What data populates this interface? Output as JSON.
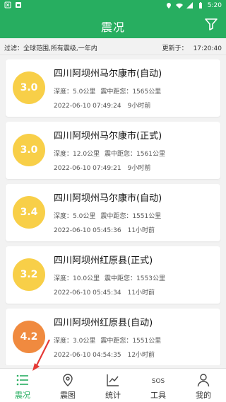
{
  "status": {
    "time": "5:20"
  },
  "header": {
    "title": "震况",
    "filter_icon": "funnel-icon"
  },
  "filter": {
    "text": "过滤：全球范围,所有震级,一年内",
    "update_label": "更新于：",
    "update_time": "17:20:40"
  },
  "colors": {
    "primary": "#27ae60",
    "mag_yellow": "#f8cf48",
    "mag_orange": "#f08a3f",
    "arrow": "#e53935"
  },
  "quakes": [
    {
      "magnitude": "3.0",
      "level": "yellow",
      "place": "四川阿坝州马尔康市(自动)",
      "depth": "深度：5.0公里",
      "distance": "震中距您：1565公里",
      "datetime": "2022-06-10 07:49:24",
      "ago": "9小时前"
    },
    {
      "magnitude": "3.0",
      "level": "yellow",
      "place": "四川阿坝州马尔康市(正式)",
      "depth": "深度：12.0公里",
      "distance": "震中距您：1561公里",
      "datetime": "2022-06-10 07:49:21",
      "ago": "9小时前"
    },
    {
      "magnitude": "3.4",
      "level": "yellow",
      "place": "四川阿坝州马尔康市(自动)",
      "depth": "深度：5.0公里",
      "distance": "震中距您：1551公里",
      "datetime": "2022-06-10 05:45:36",
      "ago": "11小时前"
    },
    {
      "magnitude": "3.2",
      "level": "yellow",
      "place": "四川阿坝州红原县(正式)",
      "depth": "深度：10.0公里",
      "distance": "震中距您：1553公里",
      "datetime": "2022-06-10 05:45:34",
      "ago": "11小时前"
    },
    {
      "magnitude": "4.2",
      "level": "orange",
      "place": "四川阿坝州红原县(自动)",
      "depth": "深度：3.0公里",
      "distance": "震中距您：1551公里",
      "datetime": "2022-06-10 04:54:35",
      "ago": "12小时前"
    }
  ],
  "tabs": [
    {
      "label": "震况",
      "icon": "list-icon",
      "active": true
    },
    {
      "label": "震图",
      "icon": "map-pin-icon",
      "active": false
    },
    {
      "label": "统计",
      "icon": "chart-icon",
      "active": false
    },
    {
      "label": "工具",
      "icon": "sos-icon",
      "active": false
    },
    {
      "label": "我的",
      "icon": "user-icon",
      "active": false
    }
  ]
}
